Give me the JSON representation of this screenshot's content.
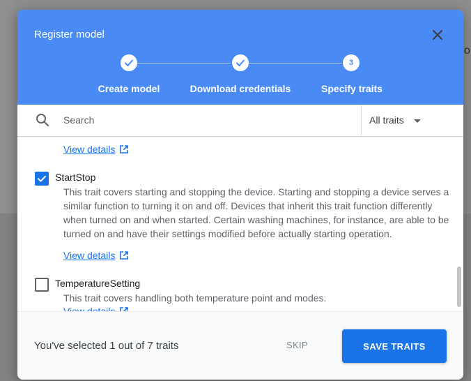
{
  "backdrop": {
    "edge_text": "o"
  },
  "dialog": {
    "title": "Register model",
    "close_icon": "close-icon"
  },
  "stepper": {
    "steps": [
      {
        "label": "Create model",
        "state": "done"
      },
      {
        "label": "Download credentials",
        "state": "done"
      },
      {
        "label": "Specify traits",
        "state": "current",
        "number": "3"
      }
    ]
  },
  "search": {
    "placeholder": "Search",
    "value": "",
    "icon": "search-icon"
  },
  "filter": {
    "selected": "All traits",
    "icon": "caret-down-icon"
  },
  "traits": [
    {
      "name": "StartStop",
      "checked": true,
      "description": "This trait covers starting and stopping the device. Starting and stopping a device serves a similar function to turning it on and off. Devices that inherit this trait function differently when turned on and when started. Certain washing machines, for instance, are able to be turned on and have their settings modified before actually starting operation.",
      "link_label": "View details"
    },
    {
      "name": "TemperatureSetting",
      "checked": false,
      "description": "This trait covers handling both temperature point and modes.",
      "link_label": "View details"
    }
  ],
  "previous_link_label": "View details",
  "footer": {
    "status": "You've selected 1 out of 7 traits",
    "skip_label": "SKIP",
    "save_label": "SAVE TRAITS"
  },
  "colors": {
    "header": "#4a8af4",
    "primary": "#1a73e8",
    "link": "#1a73e8"
  }
}
